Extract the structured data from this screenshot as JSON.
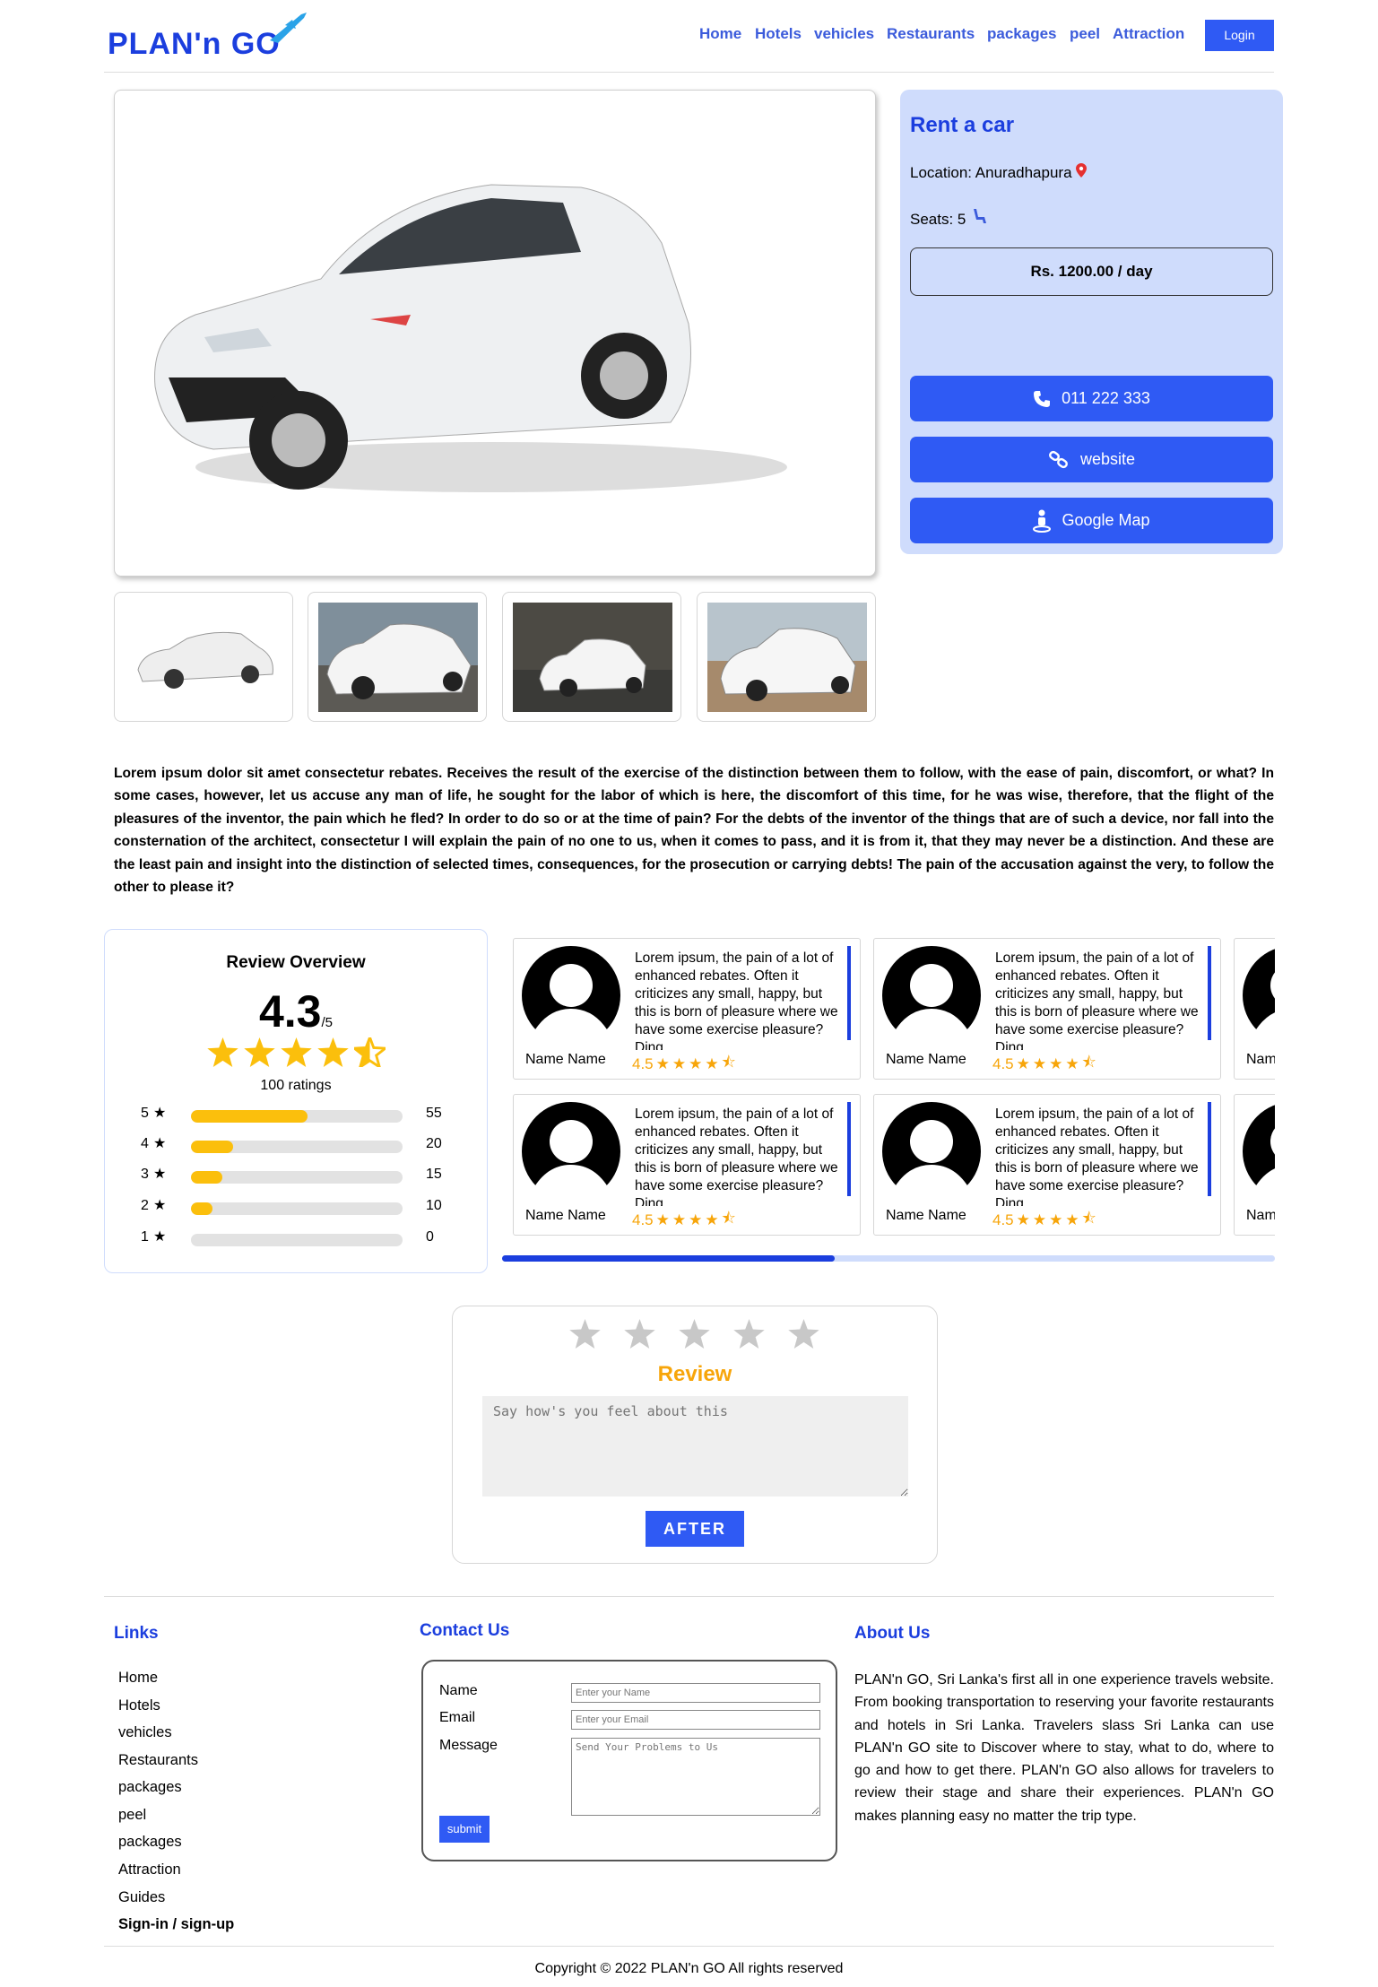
{
  "header": {
    "logo_text": "PLAN'n GO",
    "nav": [
      "Home",
      "Hotels",
      "vehicles",
      "Restaurants",
      "packages",
      "peel",
      "Attraction"
    ],
    "login": "Login",
    "brand_color": "#1b3ede"
  },
  "listing": {
    "title": "Rent a car",
    "location": "Location: Anuradhapura",
    "seats": "Seats: 5",
    "price": "Rs. 1200.00 / day",
    "phone": "011 222 333",
    "website": "website",
    "map": "Google Map"
  },
  "description": "Lorem ipsum dolor sit amet consectetur rebates. Receives the result of the exercise of the distinction between them to follow, with the ease of pain, discomfort, or what? In some cases, however, let us accuse any man of life, he sought for the labor of which is here, the discomfort of this time, for he was wise, therefore, that the flight of the pleasures of the inventor, the pain which he fled? In order to do so or at the time of pain? For the debts of the inventor of the things that are of such a device, nor fall into the consternation of the architect, consectetur I will explain the pain of no one to us, when it comes to pass, and it is from it, that they may never be a distinction. And these are the least pain and insight into the distinction of selected times, consequences, for the prosecution or carrying debts! The pain of the accusation against the very, to follow the other to please it?",
  "overview": {
    "title": "Review Overview",
    "score": "4.3",
    "out_of": "/5",
    "ratings": "100 ratings",
    "bars": [
      {
        "star": "5",
        "count": "55",
        "fraction": 0.55
      },
      {
        "star": "4",
        "count": "20",
        "fraction": 0.2
      },
      {
        "star": "3",
        "count": "15",
        "fraction": 0.15
      },
      {
        "star": "2",
        "count": "10",
        "fraction": 0.1
      },
      {
        "star": "1",
        "count": "0",
        "fraction": 0
      }
    ]
  },
  "reviews": {
    "name": "Name Name",
    "cut_name": "Nam",
    "rating": "4.5",
    "text": "Lorem ipsum, the pain of a lot of enhanced rebates. Often it criticizes any small, happy, but this is born of pleasure where we have some exercise pleasure? Ding",
    "scroll_progress": 0.43
  },
  "review_form": {
    "title": "Review",
    "placeholder": "Say how's you feel about this",
    "button": "AFTER"
  },
  "footer": {
    "links_title": "Links",
    "links": [
      "Home",
      "Hotels",
      "vehicles",
      "Restaurants",
      "packages",
      "peel",
      "packages",
      "Attraction",
      "Guides",
      "Sign-in / sign-up"
    ],
    "contact_title": "Contact Us",
    "name_label": "Name",
    "email_label": "Email",
    "message_label": "Message",
    "name_ph": "Enter your Name",
    "email_ph": "Enter your Email",
    "message_ph": "Send Your Problems to Us",
    "submit": "submit",
    "about_title": "About Us",
    "about": "PLAN'n GO, Sri Lanka's first all in one experience travels website. From booking transportation to reserving your favorite restaurants and hotels in Sri Lanka. Travelers slass Sri Lanka can use PLAN'n GO site to Discover where to stay, what to do, where to go and how to get there. PLAN'n GO also allows for travelers to review their stage and share their experiences. PLAN'n GO makes planning easy no matter the trip type.",
    "copyright": "Copyright © 2022 PLAN'n GO All rights reserved"
  }
}
